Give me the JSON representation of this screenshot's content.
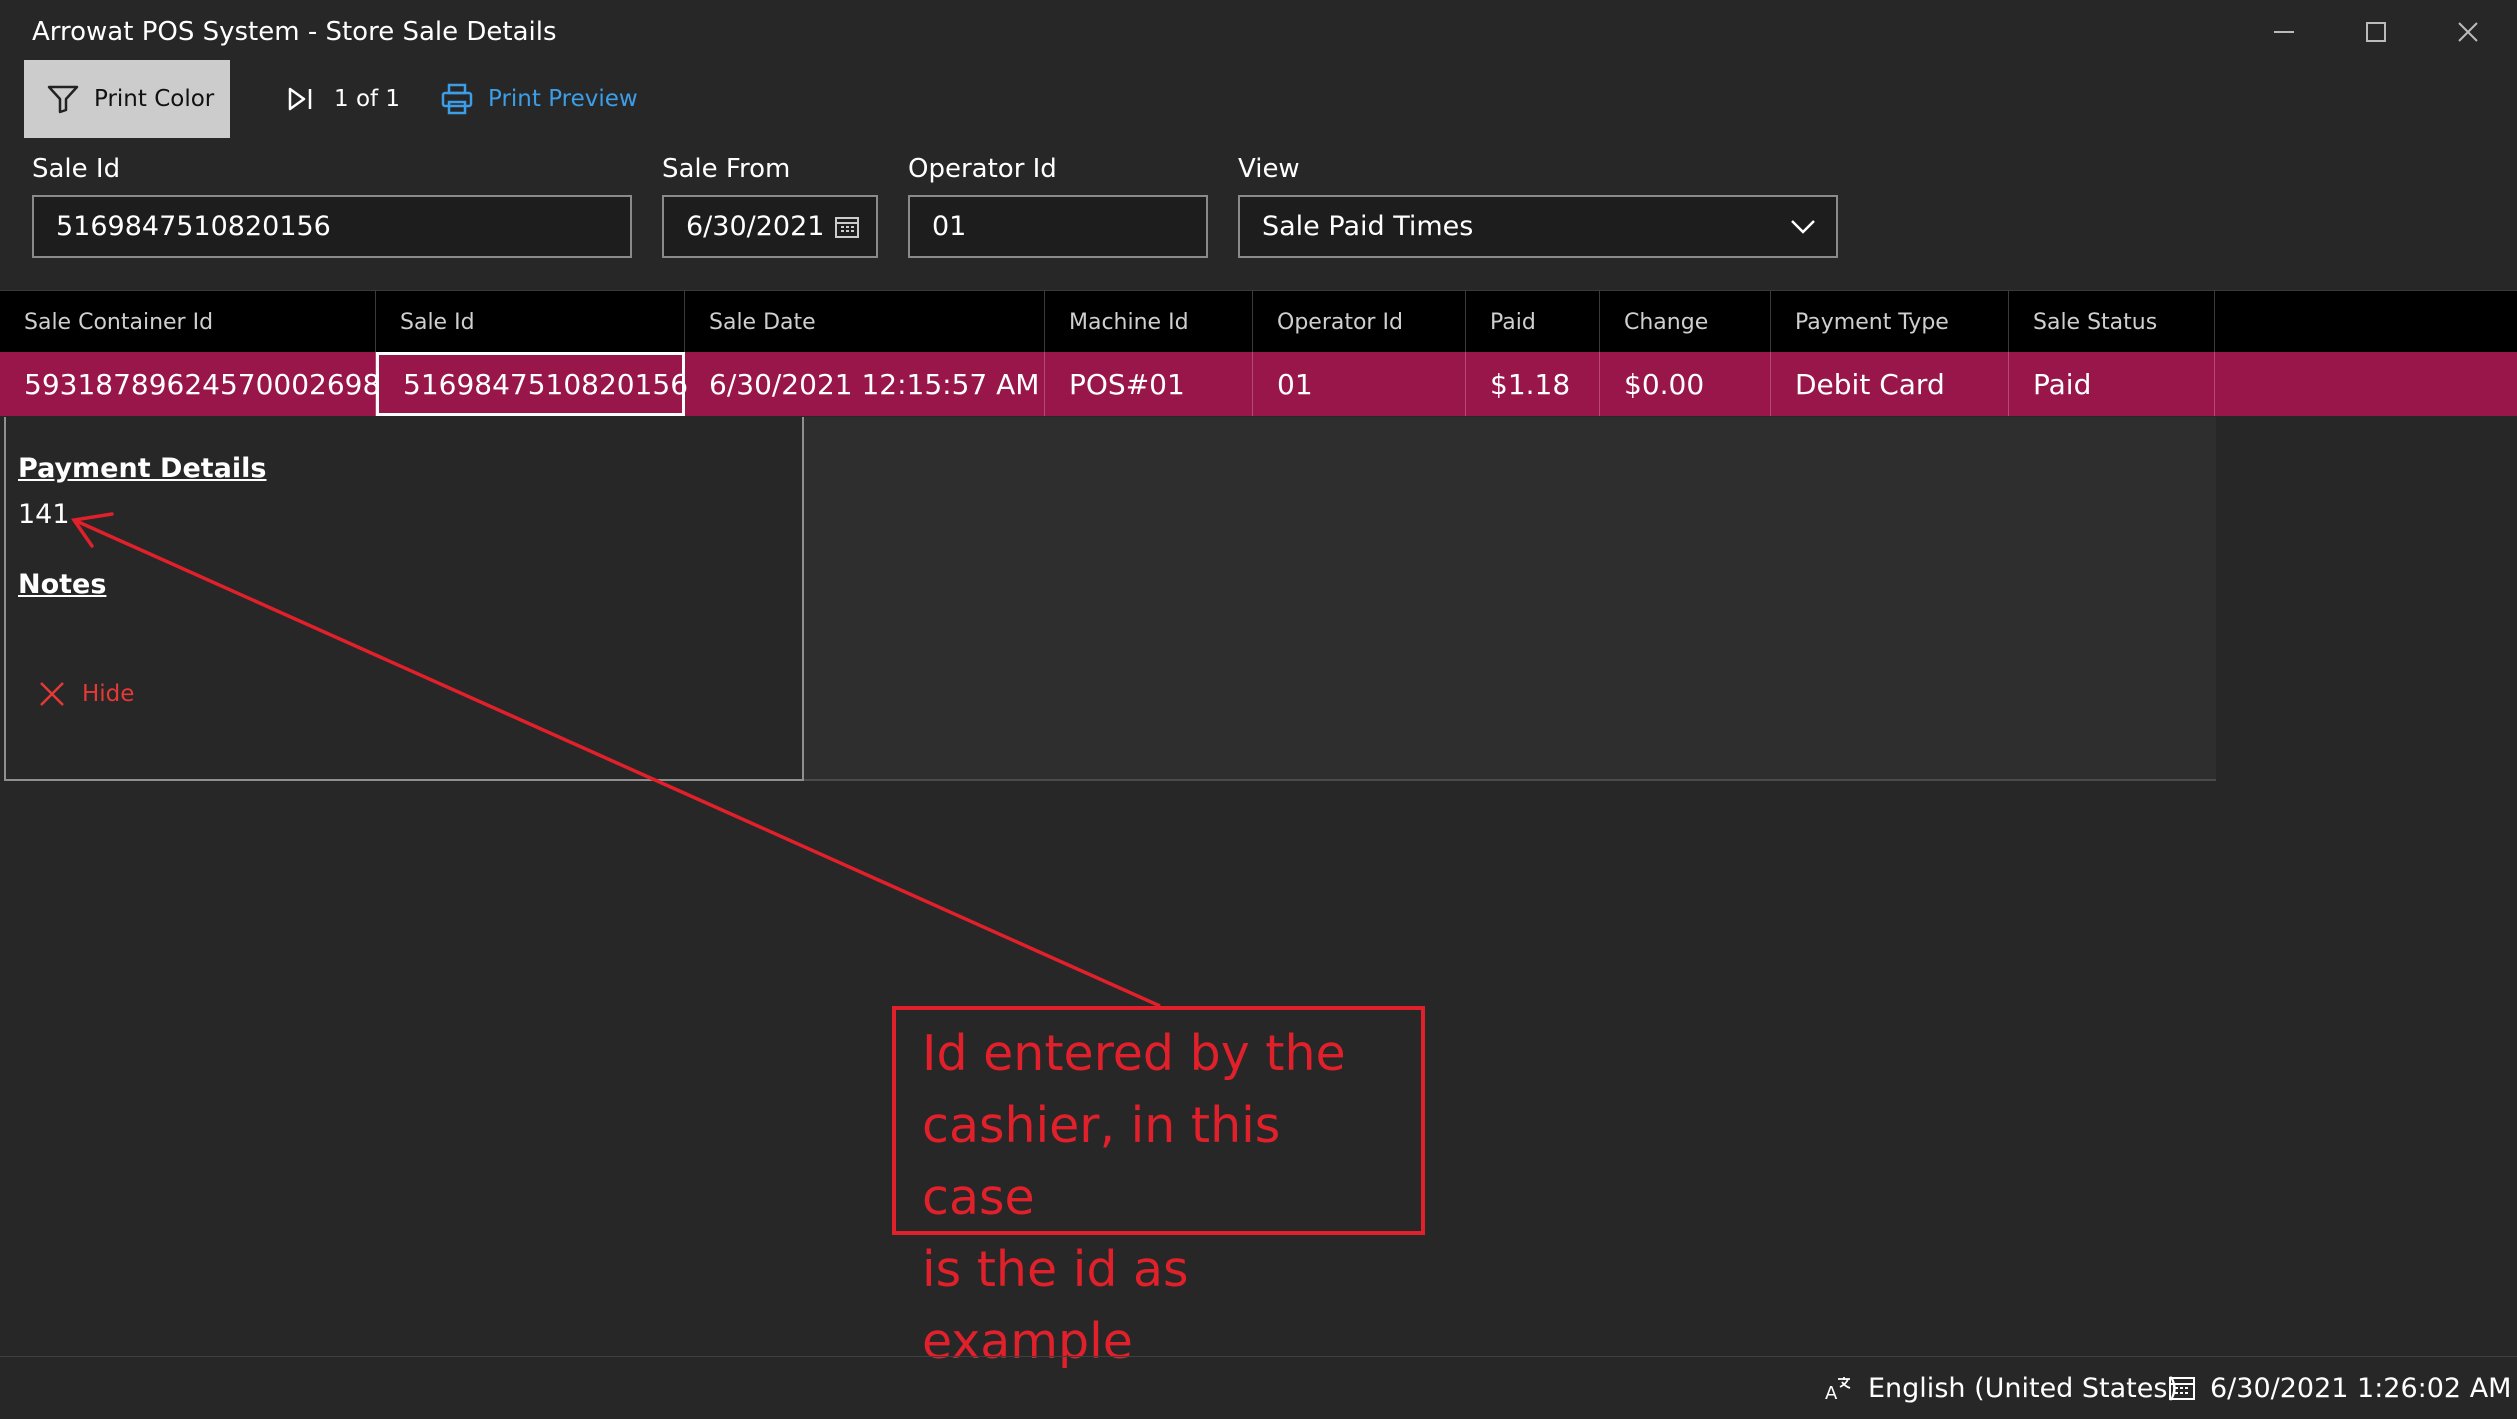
{
  "window": {
    "title": "Arrowat POS System - Store Sale Details"
  },
  "toolbar": {
    "print_color_label": "Print Color",
    "page_indicator": "1 of 1",
    "print_preview_label": "Print Preview"
  },
  "filters": {
    "sale_id": {
      "label": "Sale Id",
      "value": "5169847510820156"
    },
    "sale_from": {
      "label": "Sale From",
      "value": "6/30/2021"
    },
    "operator_id": {
      "label": "Operator Id",
      "value": "01"
    },
    "view": {
      "label": "View",
      "value": "Sale Paid Times"
    }
  },
  "grid": {
    "columns": [
      "Sale Container Id",
      "Sale Id",
      "Sale Date",
      "Machine Id",
      "Operator Id",
      "Paid",
      "Change",
      "Payment Type",
      "Sale Status"
    ],
    "rows": [
      [
        "59318789624570002698",
        "5169847510820156",
        "6/30/2021 12:15:57 AM",
        "POS#01",
        "01",
        "$1.18",
        "$0.00",
        "Debit Card",
        "Paid"
      ]
    ]
  },
  "details": {
    "payment_heading": "Payment Details",
    "payment_value": "141",
    "notes_heading": "Notes",
    "hide_label": "Hide"
  },
  "annotation": {
    "line1": "Id entered by the",
    "line2": "cashier, in this case",
    "line3": "is the id as example"
  },
  "status_bar": {
    "language": "English (United States)",
    "datetime": "6/30/2021 1:26:02 AM"
  },
  "colors": {
    "background": "#272727",
    "selected_row": "#99164a",
    "accent_blue": "#3c9ee6",
    "annotation_red": "#e0202a"
  }
}
